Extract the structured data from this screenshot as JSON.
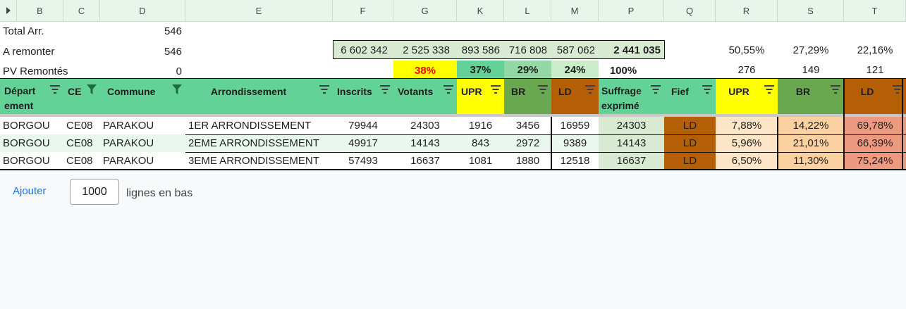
{
  "column_headers": [
    "B",
    "C",
    "D",
    "E",
    "F",
    "G",
    "K",
    "L",
    "M",
    "P",
    "Q",
    "R",
    "S",
    "T"
  ],
  "summary": {
    "total_arr": {
      "label": "Total Arr.",
      "value": "546"
    },
    "a_remonter": {
      "label": "A remonter",
      "value": "546",
      "inscrits": "6 602 342",
      "votants": "2 525 338",
      "upr": "893 586",
      "br": "716 808",
      "ld": "587 062",
      "suffrage": "2 441 035",
      "pct_upr": "50,55%",
      "pct_br": "27,29%",
      "pct_ld": "22,16%"
    },
    "pv_remontes": {
      "label": "PV Remontés",
      "value": "0",
      "pct_votants": "38%",
      "pct_upr": "37%",
      "pct_br": "29%",
      "pct_ld": "24%",
      "pct_suffrage": "100%",
      "count_upr": "276",
      "count_br": "149",
      "count_ld": "121"
    }
  },
  "table_headers": {
    "departement_1": "Départ",
    "departement_2": "ement",
    "ce": "CE",
    "commune": "Commune",
    "arrondissement": "Arrondissement",
    "inscrits": "Inscrits",
    "votants": "Votants",
    "upr": "UPR",
    "br": "BR",
    "ld": "LD",
    "suffrage_1": "Suffrage",
    "suffrage_2": "exprimé",
    "fief": "Fief",
    "pct_upr": "UPR",
    "pct_br": "BR",
    "pct_ld": "LD"
  },
  "rows": [
    {
      "departement": "BORGOU",
      "ce": "CE08",
      "commune": "PARAKOU",
      "arrondissement": "1ER ARRONDISSEMENT",
      "inscrits": "79944",
      "votants": "24303",
      "upr": "1916",
      "br": "3456",
      "ld": "16959",
      "suffrage": "24303",
      "fief": "LD",
      "pct_upr": "7,88%",
      "pct_br": "14,22%",
      "pct_ld": "69,78%"
    },
    {
      "departement": "BORGOU",
      "ce": "CE08",
      "commune": "PARAKOU",
      "arrondissement": "2EME ARRONDISSEMENT",
      "inscrits": "49917",
      "votants": "14143",
      "upr": "843",
      "br": "2972",
      "ld": "9389",
      "suffrage": "14143",
      "fief": "LD",
      "pct_upr": "5,96%",
      "pct_br": "21,01%",
      "pct_ld": "66,39%"
    },
    {
      "departement": "BORGOU",
      "ce": "CE08",
      "commune": "PARAKOU",
      "arrondissement": "3EME ARRONDISSEMENT",
      "inscrits": "57493",
      "votants": "16637",
      "upr": "1081",
      "br": "1880",
      "ld": "12518",
      "suffrage": "16637",
      "fief": "LD",
      "pct_upr": "6,50%",
      "pct_br": "11,30%",
      "pct_ld": "75,24%"
    }
  ],
  "footer": {
    "add_label": "Ajouter",
    "count_value": "1000",
    "suffix": "lignes en bas"
  },
  "colors": {
    "header_green": "#63d297",
    "upr_yellow": "#ffff00",
    "br_green": "#6aa84f",
    "ld_brown": "#b45f06",
    "red_text": "#ff0000"
  }
}
